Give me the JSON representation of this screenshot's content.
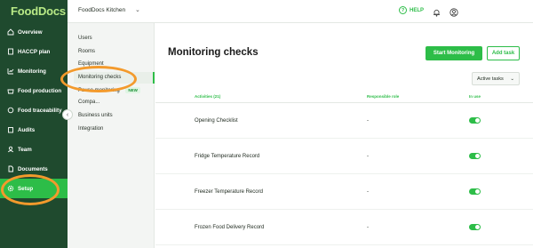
{
  "app": {
    "logo": "FoodDocs"
  },
  "topbar": {
    "org_name": "FoodDocs Kitchen",
    "help_label": "HELP"
  },
  "sidebar": {
    "items": [
      {
        "label": "Overview",
        "icon": "home-icon"
      },
      {
        "label": "HACCP plan",
        "icon": "book-icon"
      },
      {
        "label": "Monitoring",
        "icon": "chart-icon"
      },
      {
        "label": "Food production",
        "icon": "pot-icon"
      },
      {
        "label": "Food traceability",
        "icon": "refresh-icon"
      },
      {
        "label": "Audits",
        "icon": "clipboard-icon"
      },
      {
        "label": "Team",
        "icon": "team-icon"
      },
      {
        "label": "Documents",
        "icon": "document-icon"
      },
      {
        "label": "Setup",
        "icon": "gear-icon",
        "active": true
      }
    ]
  },
  "submenu": {
    "items": [
      {
        "label": "Users"
      },
      {
        "label": "Rooms"
      },
      {
        "label": "Equipment"
      },
      {
        "label": "Monitoring checks",
        "active": true
      },
      {
        "label": "Pause monitoring",
        "badge": "NEW"
      },
      {
        "label": "Compa..."
      },
      {
        "label": "Business units"
      },
      {
        "label": "Integration"
      }
    ]
  },
  "main": {
    "title": "Monitoring checks",
    "start_button": "Start Monitoring",
    "add_button": "Add task",
    "filter_label": "Active tasks",
    "columns": {
      "activities": "Activities (21)",
      "role": "Responsible role",
      "in_use": "In use"
    },
    "rows": [
      {
        "name": "Opening Checklist",
        "role": "-",
        "in_use": true
      },
      {
        "name": "Fridge Temperature Record",
        "role": "-",
        "in_use": true
      },
      {
        "name": "Freezer Temperature Record",
        "role": "-",
        "in_use": true
      },
      {
        "name": "Frozen Food Delivery Record",
        "role": "-",
        "in_use": true
      }
    ]
  },
  "colors": {
    "accent": "#2dbd48",
    "sidebar_bg": "#1f4a2e",
    "annotation": "#f39a2c"
  }
}
